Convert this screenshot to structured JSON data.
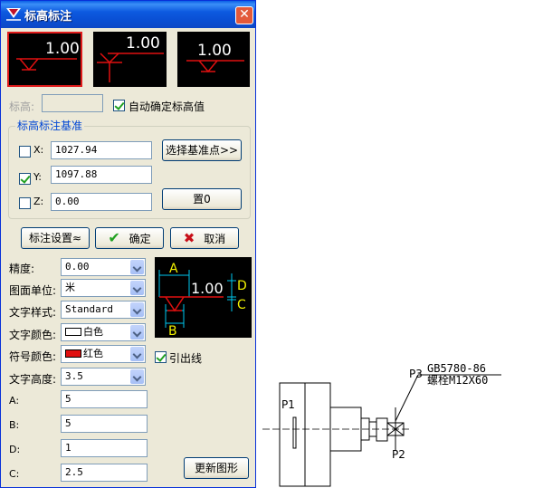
{
  "dialog": {
    "title": "标高标注",
    "close_label": "✕",
    "tiles": [
      {
        "value": "1.00",
        "selected": true
      },
      {
        "value": "1.00",
        "selected": false
      },
      {
        "value": "1.00",
        "selected": false
      }
    ],
    "elevation": {
      "label": "标高:",
      "value": "",
      "auto_label": "自动确定标高值",
      "auto_checked": true
    },
    "base_group": {
      "title": "标高标注基准",
      "x": {
        "label": "X:",
        "value": "1027.94",
        "checked": false
      },
      "y": {
        "label": "Y:",
        "value": "1097.88",
        "checked": true
      },
      "z": {
        "label": "Z:",
        "value": "0.00",
        "checked": false
      },
      "pick_button": "选择基准点>>",
      "zero_button": "置0"
    },
    "buttons": {
      "settings": "标注设置≈",
      "ok": "确定",
      "cancel": "取消"
    },
    "form": {
      "precision": {
        "label": "精度:",
        "value": "0.00"
      },
      "unit": {
        "label": "图面单位:",
        "value": "米"
      },
      "text_style": {
        "label": "文字样式:",
        "value": "Standard"
      },
      "text_color": {
        "label": "文字颜色:",
        "value": "白色",
        "swatch": "#ffffff"
      },
      "symbol_color": {
        "label": "符号颜色:",
        "value": "红色",
        "swatch": "#e01010"
      },
      "text_height": {
        "label": "文字高度:",
        "value": "3.5"
      },
      "a": {
        "label": "A:",
        "value": "5"
      },
      "b": {
        "label": "B:",
        "value": "5"
      },
      "d": {
        "label": "D:",
        "value": "1"
      },
      "c": {
        "label": "C:",
        "value": "2.5"
      },
      "leader_label": "引出线",
      "leader_checked": true,
      "update_button": "更新图形"
    },
    "preview": {
      "value": "1.00",
      "labels": {
        "a": "A",
        "b": "B",
        "d": "D",
        "c": "C"
      }
    }
  },
  "drawing": {
    "p1": "P1",
    "p2": "P2",
    "p3": "P3",
    "standard": "GB5780-86",
    "spec": "螺栓M12X60",
    "line_color": "#000000"
  }
}
